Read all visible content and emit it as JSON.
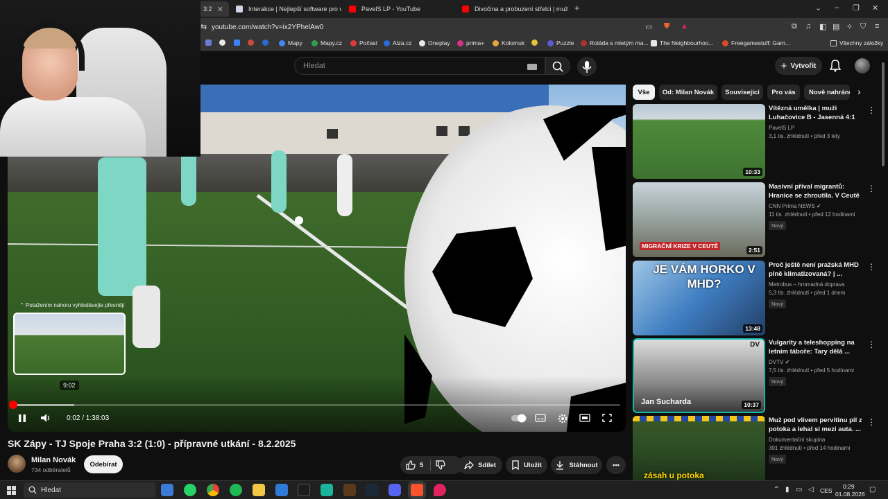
{
  "browser": {
    "tabs": [
      {
        "title": "3:2",
        "active": true
      },
      {
        "title": "Interakce | Nejlepší software pro vyle",
        "active": false
      },
      {
        "title": "PavelS LP - YouTube",
        "active": false
      },
      {
        "title": "Divočina a probuzení střelci | muži La",
        "active": false
      }
    ],
    "new_tab_label": "+",
    "url": "youtube.com/watch?v=ix2YPhelAw0",
    "bookmarks": [
      {
        "label": "Mapy",
        "color": "#4285f4"
      },
      {
        "label": "Mapy.cz",
        "color": "#2e9e4a"
      },
      {
        "label": "Počasí",
        "color": "#e03a3a"
      },
      {
        "label": "Alza.cz",
        "color": "#2b6bd6"
      },
      {
        "label": "Oneplay",
        "color": "#e8e8e8"
      },
      {
        "label": "prima+",
        "color": "#d63384"
      },
      {
        "label": "Kolomuk",
        "color": "#e8a33a"
      },
      {
        "label": "Puzzle",
        "color": "#5b5bd6"
      },
      {
        "label": "Roláda s mletým ma...",
        "color": "#b03030"
      },
      {
        "label": "The Neighbourhoo...",
        "color": "#e8e8e8"
      },
      {
        "label": "Freegamestuff: Gam...",
        "color": "#d94a2a"
      }
    ],
    "all_bookmarks_label": "Všechny záložky"
  },
  "youtube": {
    "search_placeholder": "Hledat",
    "create_label": "Vytvořit"
  },
  "player": {
    "hint": "⌃ Potažením nahoru vyhledávejte přesněji",
    "preview_time": "9:02",
    "time_display": "0:02 / 1:38:03",
    "progress_played": 0.001,
    "progress_hover": 0.1
  },
  "video": {
    "title": "SK Zápy - TJ Spoje Praha 3:2 (1:0) - přípravné utkání - 8.2.2025",
    "channel_name": "Milan Novák",
    "channel_subs": "734 odběratelů",
    "subscribe_label": "Odebírat",
    "likes": "5",
    "share_label": "Sdílet",
    "save_label": "Uložit",
    "download_label": "Stáhnout"
  },
  "chips": [
    {
      "label": "Vše",
      "active": true
    },
    {
      "label": "Od: Milan Novák",
      "active": false
    },
    {
      "label": "Související",
      "active": false
    },
    {
      "label": "Pro vás",
      "active": false
    },
    {
      "label": "Nově nahráno",
      "active": false
    }
  ],
  "recommendations": [
    {
      "title": "Vítězná umělka | muži Luhačovice B - Jasenná 4:1",
      "channel": "PavelS LP",
      "verified": false,
      "meta": "3,1 tis. zhlédnutí • před 3 lety",
      "badge": "",
      "duration": "10:33",
      "overlay": ""
    },
    {
      "title": "Masivní příval migrantů: Hranice se zhroutila. V Ceutě ...",
      "channel": "CNN Prima NEWS",
      "verified": true,
      "meta": "11 tis. zhlédnutí • před 12 hodinami",
      "badge": "Nový",
      "duration": "2:51",
      "overlay": "MIGRAČNÍ KRIZE V CEUTĚ"
    },
    {
      "title": "Proč ještě není pražská MHD plně klimatizovaná? | ...",
      "channel": "Metrobus – hromadná doprava",
      "verified": false,
      "meta": "5,3 tis. zhlédnutí • před 1 dnem",
      "badge": "Nový",
      "duration": "13:48",
      "overlay": "JE VÁM HORKO V MHD?"
    },
    {
      "title": "Vulgarity a teleshopping na letním táboře: Tary dělá ...",
      "channel": "DVTV",
      "verified": true,
      "meta": "7,5 tis. zhlédnutí • před 5 hodinami",
      "badge": "Nový",
      "duration": "10:37",
      "overlay": "Jan Sucharda"
    },
    {
      "title": "Muž pod vlivem pervitinu pil z potoka a lehal si mezi auta. ...",
      "channel": "Dokumentační skupina",
      "verified": false,
      "meta": "301 zhlédnutí • před 14 hodinami",
      "badge": "Nový",
      "duration": "",
      "overlay": "zásah u potoka"
    }
  ],
  "taskbar": {
    "search_label": "Hledat",
    "lang": "CES",
    "time": "0:29",
    "date": "01.08.2026"
  }
}
